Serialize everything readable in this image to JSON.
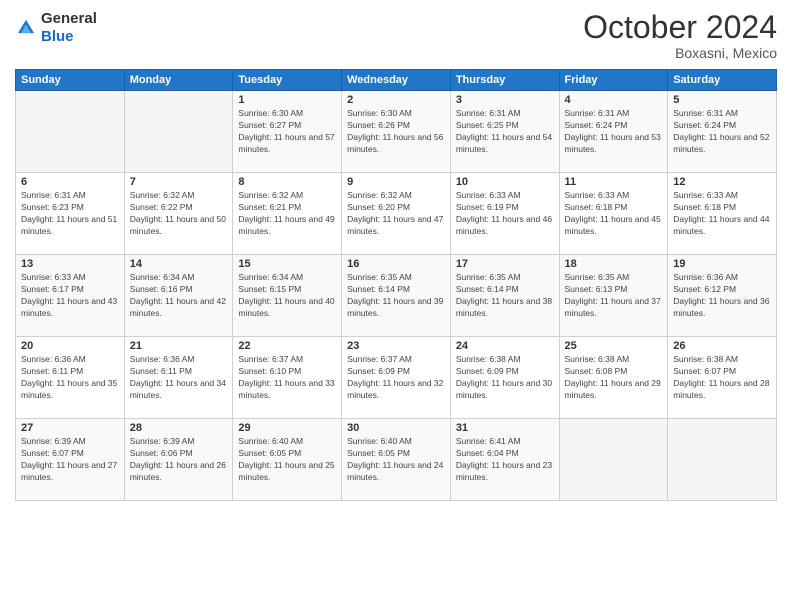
{
  "header": {
    "logo_general": "General",
    "logo_blue": "Blue",
    "month": "October 2024",
    "location": "Boxasni, Mexico"
  },
  "weekdays": [
    "Sunday",
    "Monday",
    "Tuesday",
    "Wednesday",
    "Thursday",
    "Friday",
    "Saturday"
  ],
  "weeks": [
    [
      {
        "day": "",
        "sunrise": "",
        "sunset": "",
        "daylight": ""
      },
      {
        "day": "",
        "sunrise": "",
        "sunset": "",
        "daylight": ""
      },
      {
        "day": "1",
        "sunrise": "Sunrise: 6:30 AM",
        "sunset": "Sunset: 6:27 PM",
        "daylight": "Daylight: 11 hours and 57 minutes."
      },
      {
        "day": "2",
        "sunrise": "Sunrise: 6:30 AM",
        "sunset": "Sunset: 6:26 PM",
        "daylight": "Daylight: 11 hours and 56 minutes."
      },
      {
        "day": "3",
        "sunrise": "Sunrise: 6:31 AM",
        "sunset": "Sunset: 6:25 PM",
        "daylight": "Daylight: 11 hours and 54 minutes."
      },
      {
        "day": "4",
        "sunrise": "Sunrise: 6:31 AM",
        "sunset": "Sunset: 6:24 PM",
        "daylight": "Daylight: 11 hours and 53 minutes."
      },
      {
        "day": "5",
        "sunrise": "Sunrise: 6:31 AM",
        "sunset": "Sunset: 6:24 PM",
        "daylight": "Daylight: 11 hours and 52 minutes."
      }
    ],
    [
      {
        "day": "6",
        "sunrise": "Sunrise: 6:31 AM",
        "sunset": "Sunset: 6:23 PM",
        "daylight": "Daylight: 11 hours and 51 minutes."
      },
      {
        "day": "7",
        "sunrise": "Sunrise: 6:32 AM",
        "sunset": "Sunset: 6:22 PM",
        "daylight": "Daylight: 11 hours and 50 minutes."
      },
      {
        "day": "8",
        "sunrise": "Sunrise: 6:32 AM",
        "sunset": "Sunset: 6:21 PM",
        "daylight": "Daylight: 11 hours and 49 minutes."
      },
      {
        "day": "9",
        "sunrise": "Sunrise: 6:32 AM",
        "sunset": "Sunset: 6:20 PM",
        "daylight": "Daylight: 11 hours and 47 minutes."
      },
      {
        "day": "10",
        "sunrise": "Sunrise: 6:33 AM",
        "sunset": "Sunset: 6:19 PM",
        "daylight": "Daylight: 11 hours and 46 minutes."
      },
      {
        "day": "11",
        "sunrise": "Sunrise: 6:33 AM",
        "sunset": "Sunset: 6:18 PM",
        "daylight": "Daylight: 11 hours and 45 minutes."
      },
      {
        "day": "12",
        "sunrise": "Sunrise: 6:33 AM",
        "sunset": "Sunset: 6:18 PM",
        "daylight": "Daylight: 11 hours and 44 minutes."
      }
    ],
    [
      {
        "day": "13",
        "sunrise": "Sunrise: 6:33 AM",
        "sunset": "Sunset: 6:17 PM",
        "daylight": "Daylight: 11 hours and 43 minutes."
      },
      {
        "day": "14",
        "sunrise": "Sunrise: 6:34 AM",
        "sunset": "Sunset: 6:16 PM",
        "daylight": "Daylight: 11 hours and 42 minutes."
      },
      {
        "day": "15",
        "sunrise": "Sunrise: 6:34 AM",
        "sunset": "Sunset: 6:15 PM",
        "daylight": "Daylight: 11 hours and 40 minutes."
      },
      {
        "day": "16",
        "sunrise": "Sunrise: 6:35 AM",
        "sunset": "Sunset: 6:14 PM",
        "daylight": "Daylight: 11 hours and 39 minutes."
      },
      {
        "day": "17",
        "sunrise": "Sunrise: 6:35 AM",
        "sunset": "Sunset: 6:14 PM",
        "daylight": "Daylight: 11 hours and 38 minutes."
      },
      {
        "day": "18",
        "sunrise": "Sunrise: 6:35 AM",
        "sunset": "Sunset: 6:13 PM",
        "daylight": "Daylight: 11 hours and 37 minutes."
      },
      {
        "day": "19",
        "sunrise": "Sunrise: 6:36 AM",
        "sunset": "Sunset: 6:12 PM",
        "daylight": "Daylight: 11 hours and 36 minutes."
      }
    ],
    [
      {
        "day": "20",
        "sunrise": "Sunrise: 6:36 AM",
        "sunset": "Sunset: 6:11 PM",
        "daylight": "Daylight: 11 hours and 35 minutes."
      },
      {
        "day": "21",
        "sunrise": "Sunrise: 6:36 AM",
        "sunset": "Sunset: 6:11 PM",
        "daylight": "Daylight: 11 hours and 34 minutes."
      },
      {
        "day": "22",
        "sunrise": "Sunrise: 6:37 AM",
        "sunset": "Sunset: 6:10 PM",
        "daylight": "Daylight: 11 hours and 33 minutes."
      },
      {
        "day": "23",
        "sunrise": "Sunrise: 6:37 AM",
        "sunset": "Sunset: 6:09 PM",
        "daylight": "Daylight: 11 hours and 32 minutes."
      },
      {
        "day": "24",
        "sunrise": "Sunrise: 6:38 AM",
        "sunset": "Sunset: 6:09 PM",
        "daylight": "Daylight: 11 hours and 30 minutes."
      },
      {
        "day": "25",
        "sunrise": "Sunrise: 6:38 AM",
        "sunset": "Sunset: 6:08 PM",
        "daylight": "Daylight: 11 hours and 29 minutes."
      },
      {
        "day": "26",
        "sunrise": "Sunrise: 6:38 AM",
        "sunset": "Sunset: 6:07 PM",
        "daylight": "Daylight: 11 hours and 28 minutes."
      }
    ],
    [
      {
        "day": "27",
        "sunrise": "Sunrise: 6:39 AM",
        "sunset": "Sunset: 6:07 PM",
        "daylight": "Daylight: 11 hours and 27 minutes."
      },
      {
        "day": "28",
        "sunrise": "Sunrise: 6:39 AM",
        "sunset": "Sunset: 6:06 PM",
        "daylight": "Daylight: 11 hours and 26 minutes."
      },
      {
        "day": "29",
        "sunrise": "Sunrise: 6:40 AM",
        "sunset": "Sunset: 6:05 PM",
        "daylight": "Daylight: 11 hours and 25 minutes."
      },
      {
        "day": "30",
        "sunrise": "Sunrise: 6:40 AM",
        "sunset": "Sunset: 6:05 PM",
        "daylight": "Daylight: 11 hours and 24 minutes."
      },
      {
        "day": "31",
        "sunrise": "Sunrise: 6:41 AM",
        "sunset": "Sunset: 6:04 PM",
        "daylight": "Daylight: 11 hours and 23 minutes."
      },
      {
        "day": "",
        "sunrise": "",
        "sunset": "",
        "daylight": ""
      },
      {
        "day": "",
        "sunrise": "",
        "sunset": "",
        "daylight": ""
      }
    ]
  ]
}
